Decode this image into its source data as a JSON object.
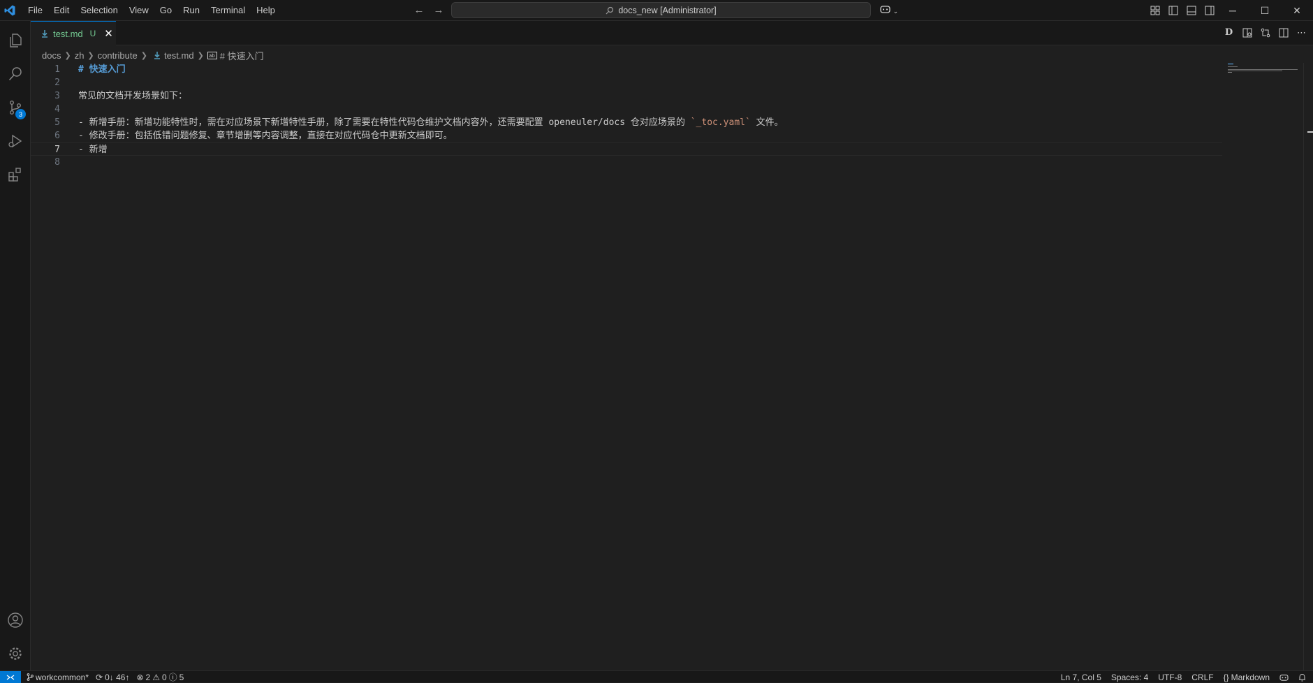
{
  "menu": [
    "File",
    "Edit",
    "Selection",
    "View",
    "Go",
    "Run",
    "Terminal",
    "Help"
  ],
  "command_center": {
    "label": "docs_new [Administrator]"
  },
  "tab": {
    "name": "test.md",
    "status": "U"
  },
  "breadcrumb": {
    "items": [
      "docs",
      "zh",
      "contribute",
      "test.md"
    ],
    "symbol": "# 快速入门"
  },
  "editor": {
    "current_line": 7,
    "lines": [
      {
        "num": "1",
        "text": "# 快速入门"
      },
      {
        "num": "2",
        "text": ""
      },
      {
        "num": "3",
        "text": "常见的文档开发场景如下："
      },
      {
        "num": "4",
        "text": ""
      },
      {
        "num": "5",
        "pre": "- 新增手册：新增功能特性时，需在对应场景下新增特性手册，除了需要在特性代码仓维护文档内容外，还需要配置 openeuler/docs 仓对应场景的 ",
        "code": "`_toc.yaml`",
        "post": " 文件。"
      },
      {
        "num": "6",
        "text": "- 修改手册：包括低错问题修复、章节增删等内容调整，直接在对应代码仓中更新文档即可。"
      },
      {
        "num": "7",
        "text": "- 新增"
      },
      {
        "num": "8",
        "text": ""
      }
    ]
  },
  "activity": {
    "source_control_badge": "3"
  },
  "status": {
    "branch": "workcommon*",
    "sync": "0↓ 46↑",
    "errors": "2",
    "warnings": "0",
    "info": "5",
    "position": "Ln 7, Col 5",
    "spaces": "Spaces: 4",
    "encoding": "UTF-8",
    "eol": "CRLF",
    "language": "Markdown"
  },
  "colors": {
    "accent": "#0078d4",
    "untracked": "#73c991",
    "heading": "#569cd6",
    "string": "#ce9178"
  }
}
